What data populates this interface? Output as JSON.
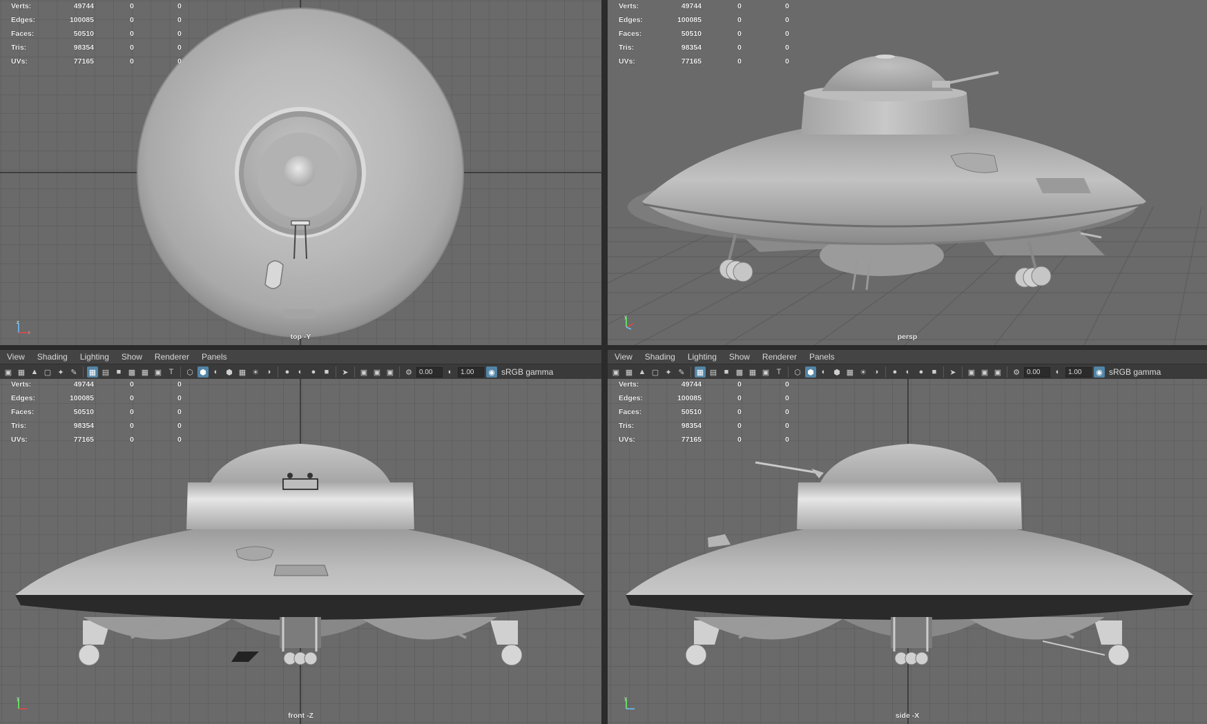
{
  "colors": {
    "selection_accent": "#5285a6"
  },
  "viewports": [
    {
      "id": "top",
      "label": "top -Y",
      "show_menu": false,
      "hud": {
        "rows": [
          {
            "key": "Verts:",
            "total": "49744",
            "selected": "0",
            "selected_obj": "0"
          },
          {
            "key": "Edges:",
            "total": "100085",
            "selected": "0",
            "selected_obj": "0"
          },
          {
            "key": "Faces:",
            "total": "50510",
            "selected": "0",
            "selected_obj": "0"
          },
          {
            "key": "Tris:",
            "total": "98354",
            "selected": "0",
            "selected_obj": "0"
          },
          {
            "key": "UVs:",
            "total": "77165",
            "selected": "0",
            "selected_obj": "0"
          }
        ]
      }
    },
    {
      "id": "persp",
      "label": "persp",
      "show_menu": false,
      "hud": {
        "rows": [
          {
            "key": "Verts:",
            "total": "49744",
            "selected": "0",
            "selected_obj": "0"
          },
          {
            "key": "Edges:",
            "total": "100085",
            "selected": "0",
            "selected_obj": "0"
          },
          {
            "key": "Faces:",
            "total": "50510",
            "selected": "0",
            "selected_obj": "0"
          },
          {
            "key": "Tris:",
            "total": "98354",
            "selected": "0",
            "selected_obj": "0"
          },
          {
            "key": "UVs:",
            "total": "77165",
            "selected": "0",
            "selected_obj": "0"
          }
        ]
      }
    },
    {
      "id": "front",
      "label": "front -Z",
      "show_menu": true,
      "hud": {
        "rows": [
          {
            "key": "Verts:",
            "total": "49744",
            "selected": "0",
            "selected_obj": "0"
          },
          {
            "key": "Edges:",
            "total": "100085",
            "selected": "0",
            "selected_obj": "0"
          },
          {
            "key": "Faces:",
            "total": "50510",
            "selected": "0",
            "selected_obj": "0"
          },
          {
            "key": "Tris:",
            "total": "98354",
            "selected": "0",
            "selected_obj": "0"
          },
          {
            "key": "UVs:",
            "total": "77165",
            "selected": "0",
            "selected_obj": "0"
          }
        ]
      }
    },
    {
      "id": "side",
      "label": "side -X",
      "show_menu": true,
      "hud": {
        "rows": [
          {
            "key": "Verts:",
            "total": "49744",
            "selected": "0",
            "selected_obj": "0"
          },
          {
            "key": "Edges:",
            "total": "100085",
            "selected": "0",
            "selected_obj": "0"
          },
          {
            "key": "Faces:",
            "total": "50510",
            "selected": "0",
            "selected_obj": "0"
          },
          {
            "key": "Tris:",
            "total": "98354",
            "selected": "0",
            "selected_obj": "0"
          },
          {
            "key": "UVs:",
            "total": "77165",
            "selected": "0",
            "selected_obj": "0"
          }
        ]
      }
    }
  ],
  "panel_menu": [
    "View",
    "Shading",
    "Lighting",
    "Show",
    "Renderer",
    "Panels"
  ],
  "toolbar": {
    "exposure_value": "0.00",
    "gamma_value": "1.00",
    "color_space_label": "sRGB gamma"
  }
}
